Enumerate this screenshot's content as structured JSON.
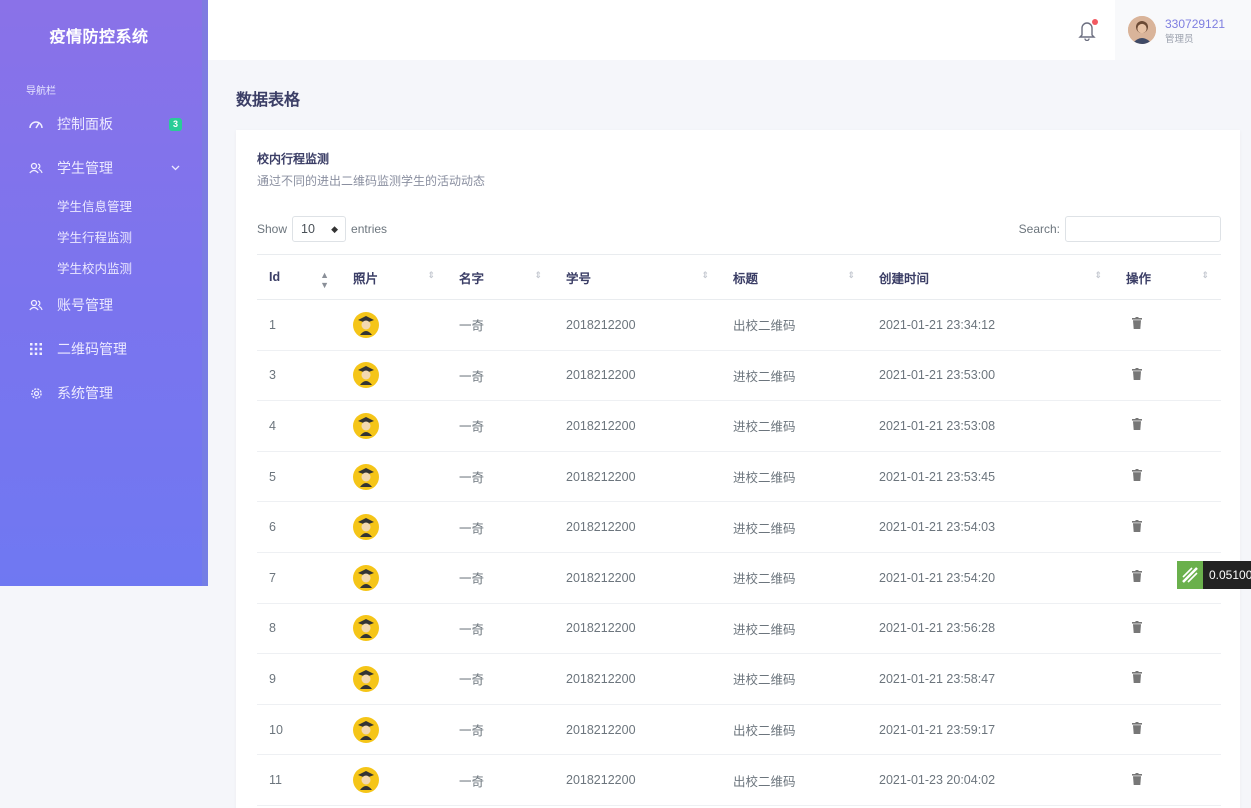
{
  "app": {
    "title": "疫情防控系统"
  },
  "sidebar": {
    "header": "导航栏",
    "items": [
      {
        "label": "控制面板",
        "icon": "gauge-icon",
        "badge": "3"
      },
      {
        "label": "学生管理",
        "icon": "users-icon",
        "expanded": true,
        "children": [
          {
            "label": "学生信息管理"
          },
          {
            "label": "学生行程监测"
          },
          {
            "label": "学生校内监测"
          }
        ]
      },
      {
        "label": "账号管理",
        "icon": "users-icon"
      },
      {
        "label": "二维码管理",
        "icon": "grid-icon"
      },
      {
        "label": "系统管理",
        "icon": "gear-icon"
      }
    ]
  },
  "topbar": {
    "user_id": "330729121",
    "user_role": "管理员"
  },
  "page": {
    "title": "数据表格"
  },
  "card": {
    "title": "校内行程监测",
    "subtitle": "通过不同的进出二维码监测学生的活动动态"
  },
  "table_controls": {
    "show_label": "Show",
    "page_size": "10",
    "entries_label": "entries",
    "search_label": "Search:"
  },
  "table": {
    "columns": [
      "Id",
      "照片",
      "名字",
      "学号",
      "标题",
      "创建时间",
      "操作"
    ],
    "rows": [
      {
        "id": "1",
        "name": "一奇",
        "student_no": "2018212200",
        "title": "出校二维码",
        "created": "2021-01-21 23:34:12"
      },
      {
        "id": "3",
        "name": "一奇",
        "student_no": "2018212200",
        "title": "进校二维码",
        "created": "2021-01-21 23:53:00"
      },
      {
        "id": "4",
        "name": "一奇",
        "student_no": "2018212200",
        "title": "进校二维码",
        "created": "2021-01-21 23:53:08"
      },
      {
        "id": "5",
        "name": "一奇",
        "student_no": "2018212200",
        "title": "进校二维码",
        "created": "2021-01-21 23:53:45"
      },
      {
        "id": "6",
        "name": "一奇",
        "student_no": "2018212200",
        "title": "进校二维码",
        "created": "2021-01-21 23:54:03"
      },
      {
        "id": "7",
        "name": "一奇",
        "student_no": "2018212200",
        "title": "进校二维码",
        "created": "2021-01-21 23:54:20"
      },
      {
        "id": "8",
        "name": "一奇",
        "student_no": "2018212200",
        "title": "进校二维码",
        "created": "2021-01-21 23:56:28"
      },
      {
        "id": "9",
        "name": "一奇",
        "student_no": "2018212200",
        "title": "进校二维码",
        "created": "2021-01-21 23:58:47"
      },
      {
        "id": "10",
        "name": "一奇",
        "student_no": "2018212200",
        "title": "出校二维码",
        "created": "2021-01-21 23:59:17"
      },
      {
        "id": "11",
        "name": "一奇",
        "student_no": "2018212200",
        "title": "出校二维码",
        "created": "2021-01-23 20:04:02"
      }
    ]
  },
  "float_widget": {
    "value": "0.05100"
  },
  "colors": {
    "sidebar_top": "#8a72e8",
    "sidebar_bottom": "#6f78f2",
    "badge": "#29cc97",
    "accent": "#7e7ee0"
  }
}
